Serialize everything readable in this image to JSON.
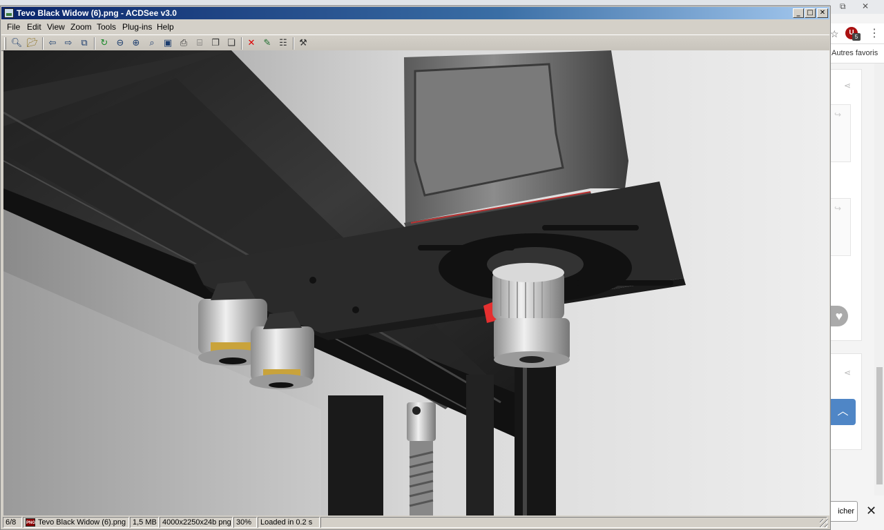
{
  "window": {
    "title": "Tevo Black Widow (6).png - ACDSee v3.0"
  },
  "menu": [
    "File",
    "Edit",
    "View",
    "Zoom",
    "Tools",
    "Plug-ins",
    "Help"
  ],
  "toolbar_icons": [
    "browse-icon",
    "open-icon",
    "previous-icon",
    "next-icon",
    "slideshow-icon",
    "rotate-icon",
    "zoom-out-icon",
    "zoom-in-icon",
    "zoom-fit-icon",
    "full-screen-icon",
    "print-icon",
    "acquire-icon",
    "copy-icon",
    "paste-icon",
    "delete-icon",
    "rename-icon",
    "properties-icon",
    "tools-icon"
  ],
  "status": {
    "index": "6/8",
    "filename": "Tevo Black Widow (6).png",
    "size": "1,5 MB",
    "dimensions": "4000x2250x24b png",
    "zoom": "30%",
    "load_time": "Loaded in 0.2 s"
  },
  "browser": {
    "bookmarks_label": "Autres favoris",
    "extension_count": "5",
    "cookie_button": "icher"
  }
}
